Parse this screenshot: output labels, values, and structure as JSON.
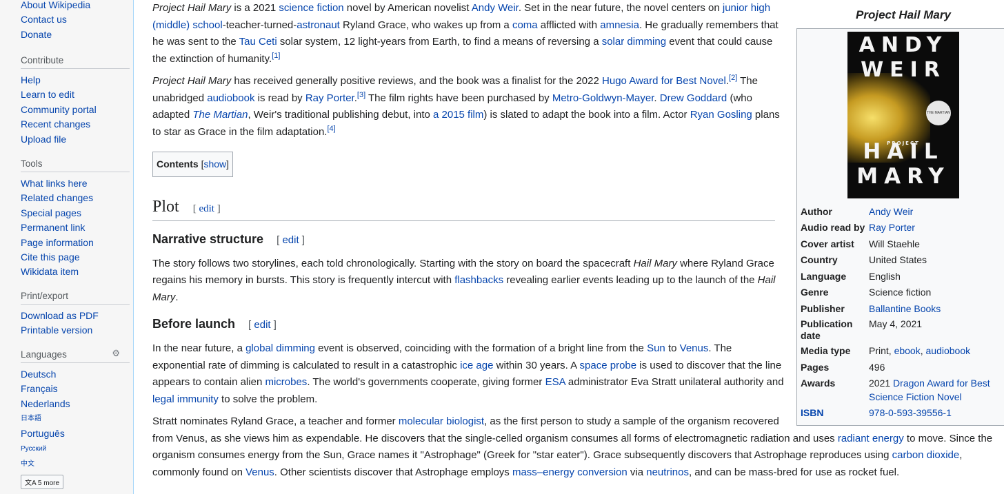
{
  "sidebar": {
    "top_links": [
      "About Wikipedia",
      "Contact us",
      "Donate"
    ],
    "contribute": {
      "heading": "Contribute",
      "items": [
        "Help",
        "Learn to edit",
        "Community portal",
        "Recent changes",
        "Upload file"
      ]
    },
    "tools": {
      "heading": "Tools",
      "items": [
        "What links here",
        "Related changes",
        "Special pages",
        "Permanent link",
        "Page information",
        "Cite this page",
        "Wikidata item"
      ]
    },
    "print": {
      "heading": "Print/export",
      "items": [
        "Download as PDF",
        "Printable version"
      ]
    },
    "languages": {
      "heading": "Languages",
      "items": [
        "Deutsch",
        "Français",
        "Nederlands",
        "日本語",
        "Português",
        "Русский",
        "中文"
      ],
      "more": "5 more"
    }
  },
  "intro": {
    "p1": [
      "Project Hail Mary",
      " is a 2021 ",
      "science fiction",
      " novel by American novelist ",
      "Andy Weir",
      ". Set in the near future, the novel centers on ",
      "junior high (middle) school",
      "-teacher-turned-",
      "astronaut",
      " Ryland Grace, who wakes up from a ",
      "coma",
      " afflicted with ",
      "amnesia",
      ". He gradually remembers that he was sent to the ",
      "Tau Ceti",
      " solar system, 12 light-years from Earth, to find a means of reversing a ",
      "solar dimming",
      " event that could cause the extinction of humanity.",
      "[1]"
    ],
    "p2": [
      "Project Hail Mary",
      " has received generally positive reviews, and the book was a finalist for the 2022 ",
      "Hugo Award for Best Novel",
      ".",
      "[2]",
      " The unabridged ",
      "audiobook",
      " is read by ",
      "Ray Porter",
      ".",
      "[3]",
      " The film rights have been purchased by ",
      "Metro-Goldwyn-Mayer",
      ". ",
      "Drew Goddard",
      " (who adapted ",
      "The Martian",
      ", Weir's traditional publishing debut, into ",
      "a 2015 film",
      ") is slated to adapt the book into a film. Actor ",
      "Ryan Gosling",
      " plans to star as Grace in the film adaptation.",
      "[4]"
    ]
  },
  "toc": {
    "label": "Contents",
    "bracket_open": "[",
    "show": "show",
    "bracket_close": "]"
  },
  "sections": {
    "plot": {
      "title": "Plot",
      "edit": "edit"
    },
    "narrative": {
      "title": "Narrative structure",
      "edit": "edit",
      "p": [
        "The story follows two storylines, each told chronologically. Starting with the story on board the spacecraft ",
        "Hail Mary",
        " where Ryland Grace regains his memory in bursts. This story is frequently intercut with ",
        "flashbacks",
        " revealing earlier events leading up to the launch of the ",
        "Hail Mary",
        "."
      ]
    },
    "before": {
      "title": "Before launch",
      "edit": "edit",
      "p1": [
        "In the near future, a ",
        "global dimming",
        " event is observed, coinciding with the formation of a bright line from the ",
        "Sun",
        " to ",
        "Venus",
        ". The exponential rate of dimming is calculated to result in a catastrophic ",
        "ice age",
        " within 30 years. A ",
        "space probe",
        " is used to discover that the line appears to contain alien ",
        "microbes",
        ". The world's governments cooperate, giving former ",
        "ESA",
        " administrator Eva Stratt unilateral authority and ",
        "legal immunity",
        " to solve the problem."
      ],
      "p2": [
        "Stratt nominates Ryland Grace, a teacher and former ",
        "molecular biologist",
        ", as the first person to study a sample of the organism recovered from Venus, as she views him as expendable. He discovers that the single-celled organism consumes all forms of electromagnetic radiation and uses ",
        "radiant energy",
        " to move. Since the organism consumes energy from the Sun, Grace names it \"Astrophage\" (Greek for \"star eater\"). Grace subsequently discovers that Astrophage reproduces using ",
        "carbon dioxide",
        ", commonly found on ",
        "Venus",
        ". Other scientists discover that Astrophage employs ",
        "mass–energy conversion",
        " via ",
        "neutrinos",
        ", and can be mass-bred for use as rocket fuel."
      ]
    }
  },
  "infobox": {
    "title": "Project Hail Mary",
    "cover": {
      "author_line1": "ANDY",
      "author_line2": "WEIR",
      "small": "PROJECT",
      "title1": "HAIL",
      "title2": "MARY",
      "badge": "THE MARTIAN"
    },
    "rows": [
      {
        "label": "Author",
        "value": "Andy Weir"
      },
      {
        "label": "Audio read by",
        "value": "Ray Porter"
      },
      {
        "label": "Cover artist",
        "value": "Will Staehle"
      },
      {
        "label": "Country",
        "value": "United States"
      },
      {
        "label": "Language",
        "value": "English"
      },
      {
        "label": "Genre",
        "value": "Science fiction"
      },
      {
        "label": "Publisher",
        "value": "Ballantine Books"
      },
      {
        "label": "Publication date",
        "value": "May 4, 2021"
      },
      {
        "label": "Media type",
        "value": [
          "Print, ",
          "ebook",
          ", ",
          "audiobook"
        ]
      },
      {
        "label": "Pages",
        "value": "496"
      },
      {
        "label": "Awards",
        "value": [
          "2021 ",
          "Dragon Award for Best Science Fiction Novel"
        ]
      },
      {
        "label": "ISBN",
        "value": "978-0-593-39556-1"
      }
    ]
  }
}
